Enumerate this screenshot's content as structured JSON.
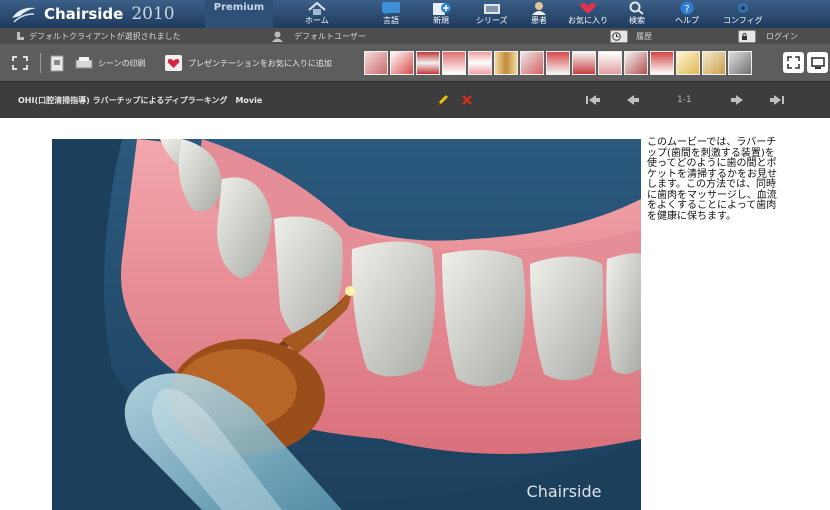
{
  "app": {
    "name": "Chairside",
    "year": "2010",
    "edition": "Premium"
  },
  "nav": [
    {
      "label": "ホーム"
    },
    {
      "label": "言語"
    },
    {
      "label": "新規"
    },
    {
      "label": "シリーズ"
    },
    {
      "label": "患者"
    },
    {
      "label": "お気に入り"
    },
    {
      "label": "検索"
    },
    {
      "label": "ヘルプ"
    },
    {
      "label": "コンフィグ"
    }
  ],
  "status": {
    "client": "デフォルトクライアントが選択されました",
    "user": "デフォルトユーザー",
    "history": "履歴",
    "login": "ログイン"
  },
  "toolbar": {
    "print_scene": "シーンの印刷",
    "add_favorite": "プレゼンテーションをお気に入りに追加"
  },
  "movie": {
    "title": "OHI(口腔清掃指導) ラバーチップによるディプラーキング　Movie",
    "page": "1-1",
    "watermark": "Chairside",
    "description": "このムービーでは、ラバーチップ(歯間を刺激する装置)を使ってどのように歯の間とポケットを清掃するかをお見せします。この方法では、同時に歯肉をマッサージし、血流をよくすることによって歯肉を健康に保ちます。"
  },
  "colors": {
    "top_bar": "#2a4a70",
    "toolbar": "#5d5d5d",
    "title_bar": "#3d3d3d",
    "edit_icon": "#f5c400",
    "delete_icon": "#e02a1a"
  }
}
